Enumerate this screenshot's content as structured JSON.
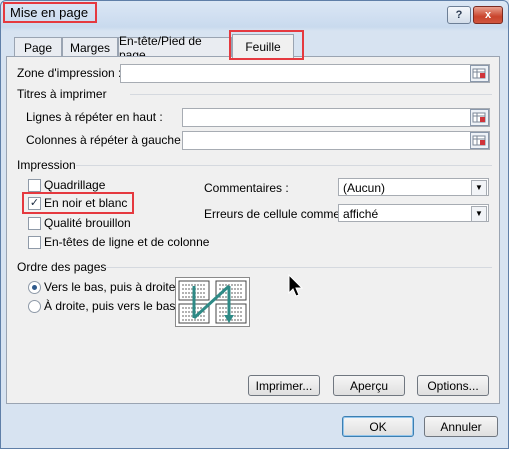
{
  "window": {
    "title": "Mise en page",
    "help_label": "?",
    "close_label": "x"
  },
  "tabs": [
    {
      "label": "Page"
    },
    {
      "label": "Marges"
    },
    {
      "label": "En-tête/Pied de page"
    },
    {
      "label": "Feuille"
    }
  ],
  "print_area": {
    "label": "Zone d'impression :",
    "value": ""
  },
  "print_titles": {
    "heading": "Titres à imprimer",
    "rows_label": "Lignes à répéter en haut :",
    "rows_value": "",
    "cols_label": "Colonnes à répéter à gauche :",
    "cols_value": ""
  },
  "print": {
    "heading": "Impression",
    "gridlines": {
      "label": "Quadrillage",
      "checked": false
    },
    "black_white": {
      "label": "En noir et blanc",
      "checked": true
    },
    "draft": {
      "label": "Qualité brouillon",
      "checked": false
    },
    "headings": {
      "label": "En-têtes de ligne et de colonne",
      "checked": false
    },
    "comments_label": "Commentaires :",
    "comments_value": "(Aucun)",
    "errors_label": "Erreurs de cellule comme :",
    "errors_value": "affiché"
  },
  "page_order": {
    "heading": "Ordre des pages",
    "down_then_over": "Vers le bas, puis à droite",
    "over_then_down": "À droite, puis vers le bas",
    "selected": "down_then_over"
  },
  "buttons": {
    "print": "Imprimer...",
    "preview": "Aperçu",
    "options": "Options...",
    "ok": "OK",
    "cancel": "Annuler"
  },
  "colors": {
    "highlight": "#e5393f",
    "accent": "#2f5a8c"
  }
}
